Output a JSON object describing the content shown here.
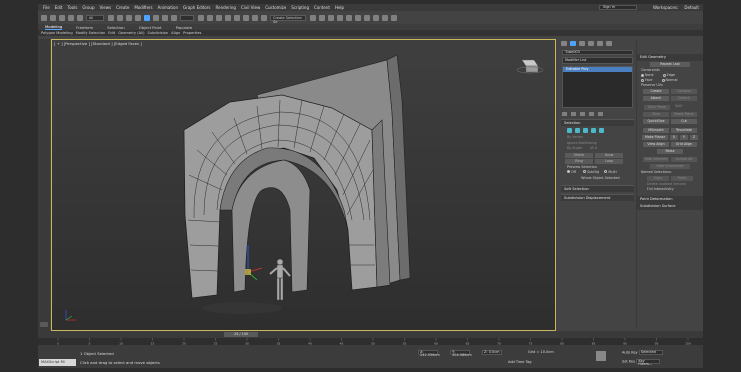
{
  "menu": [
    "File",
    "Edit",
    "Tools",
    "Group",
    "Views",
    "Create",
    "Modifiers",
    "Animation",
    "Graph Editors",
    "Rendering",
    "Civil View",
    "Customize",
    "Scripting",
    "Content",
    "Help"
  ],
  "account": {
    "signin": "Sign In",
    "workspace_label": "Workspaces:",
    "workspace": "Default"
  },
  "toolbar": {
    "filter": "All",
    "selection_set": "Create Selection Se"
  },
  "ribbon": {
    "tabs": [
      "Modeling",
      "Freeform",
      "Selection",
      "Object Paint",
      "Populate"
    ],
    "active": "Modeling",
    "subtabs": [
      "Polygon Modeling",
      "Modify Selection",
      "Edit",
      "Geometry (All)",
      "Subdivision",
      "Align",
      "Properties"
    ]
  },
  "viewport": {
    "label": "[ + ] [Perspective ] [Standard ] [Edged Faces ]"
  },
  "command_panel": {
    "object_name": "Tube003",
    "modifier_list": "Modifier List",
    "stack_item": "Editable Poly",
    "selection": {
      "title": "Selection",
      "by_vertex": "By Vertex",
      "ignore_backfacing": "Ignore Backfacing",
      "by_angle": "By Angle:",
      "angle_value": "45.0",
      "shrink": "Shrink",
      "grow": "Grow",
      "ring": "Ring",
      "loop": "Loop",
      "preview_label": "Preview Selection",
      "preview_off": "Off",
      "preview_subobj": "SubObj",
      "preview_multi": "Multi",
      "status": "Whole Object Selected"
    },
    "soft_selection": "Soft Selection",
    "subdivision_displacement": "Subdivision Displacement"
  },
  "edit_geometry": {
    "title": "Edit Geometry",
    "repeat_last": "Repeat Last",
    "constraints": "Constraints",
    "c_none": "None",
    "c_edge": "Edge",
    "c_face": "Face",
    "c_normal": "Normal",
    "preserve_uvs": "Preserve UVs",
    "create": "Create",
    "collapse": "Collapse",
    "attach": "Attach",
    "detach": "Detach",
    "slice_plane": "Slice Plane",
    "split": "Split",
    "slice": "Slice",
    "reset_plane": "Reset Plane",
    "quickslice": "QuickSlice",
    "cut": "Cut",
    "msmooth": "MSmooth",
    "tessellate": "Tessellate",
    "make_planar": "Make Planar",
    "x": "X",
    "y": "Y",
    "z": "Z",
    "view_align": "View Align",
    "grid_align": "Grid Align",
    "relax": "Relax",
    "hide_selected": "Hide Selected",
    "unhide_all": "Unhide All",
    "hide_unselected": "Hide Unselected",
    "named_selections": "Named Selections:",
    "copy": "Copy",
    "paste": "Paste",
    "delete_isolated": "Delete Isolated Vertices",
    "full_interactivity": "Full Interactivity",
    "paint_deformation": "Paint Deformation",
    "subdivision_surface": "Subdivision Surface"
  },
  "timeline": {
    "frame": "24 / 100",
    "ticks": [
      "0",
      "5",
      "10",
      "15",
      "20",
      "25",
      "30",
      "35",
      "40",
      "45",
      "50",
      "55",
      "60",
      "65",
      "70",
      "75",
      "80",
      "85",
      "90",
      "95",
      "100"
    ]
  },
  "status": {
    "maxscript": "MAXScript Mi",
    "line1": "1 Object Selected",
    "line2": "Click and drag to select and move objects",
    "x": "X: 242.556cm",
    "y": "Y: 304.586cm",
    "z": "Z: 0.0cm",
    "grid": "Grid = 10.0cm",
    "add_time_tag": "Add Time Tag",
    "auto_key": "Auto Key",
    "auto_value": "Selected",
    "set_key": "Set Key",
    "set_value": "Key Filters..."
  },
  "colors": {
    "viewport_border": "#c8b85a",
    "accent": "#4da3ff",
    "selected_item": "#4a7fc0"
  }
}
